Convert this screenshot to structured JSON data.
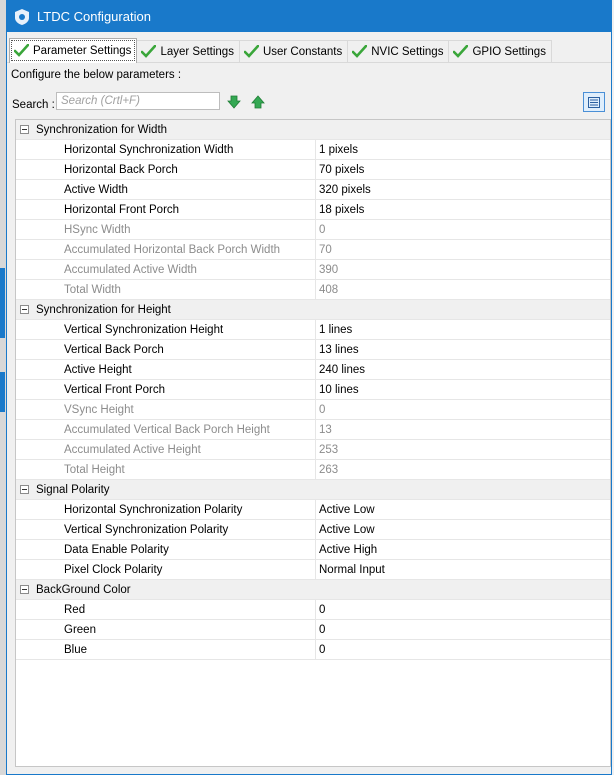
{
  "window": {
    "title": "LTDC Configuration"
  },
  "tabs": [
    {
      "label": "Parameter Settings",
      "active": true
    },
    {
      "label": "Layer Settings"
    },
    {
      "label": "User Constants"
    },
    {
      "label": "NVIC Settings"
    },
    {
      "label": "GPIO Settings"
    }
  ],
  "configure_text": "Configure the below parameters :",
  "search": {
    "label": "Search :",
    "placeholder": "Search (Crtl+F)"
  },
  "colors": {
    "title_bar": "#1979ca",
    "check": "#3aa63a",
    "arrow": "#34a853"
  },
  "groups": [
    {
      "title": "Synchronization for Width",
      "rows": [
        {
          "name": "Horizontal Synchronization Width",
          "value": "1 pixels"
        },
        {
          "name": "Horizontal Back Porch",
          "value": "70 pixels"
        },
        {
          "name": "Active Width",
          "value": "320 pixels"
        },
        {
          "name": "Horizontal Front Porch",
          "value": "18 pixels"
        },
        {
          "name": "HSync Width",
          "value": "0",
          "disabled": true
        },
        {
          "name": "Accumulated Horizontal Back Porch Width",
          "value": "70",
          "disabled": true
        },
        {
          "name": "Accumulated Active Width",
          "value": "390",
          "disabled": true
        },
        {
          "name": "Total Width",
          "value": "408",
          "disabled": true
        }
      ]
    },
    {
      "title": "Synchronization for Height",
      "rows": [
        {
          "name": "Vertical Synchronization Height",
          "value": "1 lines"
        },
        {
          "name": "Vertical Back Porch",
          "value": "13 lines"
        },
        {
          "name": "Active Height",
          "value": "240 lines"
        },
        {
          "name": "Vertical Front Porch",
          "value": "10 lines"
        },
        {
          "name": "VSync Height",
          "value": "0",
          "disabled": true
        },
        {
          "name": "Accumulated Vertical Back Porch Height",
          "value": "13",
          "disabled": true
        },
        {
          "name": "Accumulated Active Height",
          "value": "253",
          "disabled": true
        },
        {
          "name": "Total Height",
          "value": "263",
          "disabled": true
        }
      ]
    },
    {
      "title": "Signal Polarity",
      "rows": [
        {
          "name": "Horizontal Synchronization Polarity",
          "value": "Active Low"
        },
        {
          "name": "Vertical Synchronization Polarity",
          "value": "Active Low"
        },
        {
          "name": "Data Enable Polarity",
          "value": "Active High"
        },
        {
          "name": "Pixel Clock Polarity",
          "value": "Normal Input"
        }
      ]
    },
    {
      "title": "BackGround Color",
      "rows": [
        {
          "name": "Red",
          "value": "0"
        },
        {
          "name": "Green",
          "value": "0"
        },
        {
          "name": "Blue",
          "value": "0"
        }
      ]
    }
  ]
}
